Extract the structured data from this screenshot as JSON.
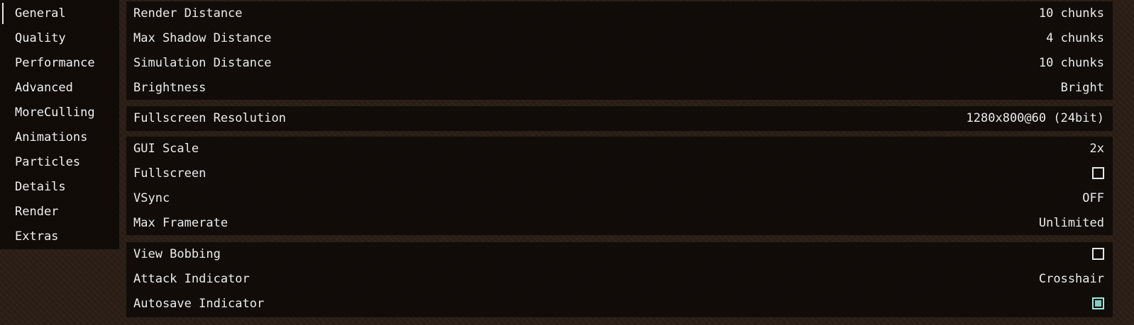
{
  "sidebar": {
    "items": [
      {
        "label": "General",
        "selected": true
      },
      {
        "label": "Quality"
      },
      {
        "label": "Performance"
      },
      {
        "label": "Advanced"
      },
      {
        "label": "MoreCulling"
      },
      {
        "label": "Animations"
      },
      {
        "label": "Particles"
      },
      {
        "label": "Details"
      },
      {
        "label": "Render"
      },
      {
        "label": "Extras"
      }
    ]
  },
  "groups": [
    {
      "options": [
        {
          "label": "Render Distance",
          "value": "10 chunks"
        },
        {
          "label": "Max Shadow Distance",
          "value": "4 chunks"
        },
        {
          "label": "Simulation Distance",
          "value": "10 chunks"
        },
        {
          "label": "Brightness",
          "value": "Bright"
        }
      ]
    },
    {
      "options": [
        {
          "label": "Fullscreen Resolution",
          "value": "1280x800@60 (24bit)"
        }
      ]
    },
    {
      "options": [
        {
          "label": "GUI Scale",
          "value": "2x"
        },
        {
          "label": "Fullscreen",
          "checked": false
        },
        {
          "label": "VSync",
          "value": "OFF"
        },
        {
          "label": "Max Framerate",
          "value": "Unlimited"
        }
      ]
    },
    {
      "options": [
        {
          "label": "View Bobbing",
          "checked": false
        },
        {
          "label": "Attack Indicator",
          "value": "Crosshair"
        },
        {
          "label": "Autosave Indicator",
          "checked": true
        }
      ]
    }
  ]
}
